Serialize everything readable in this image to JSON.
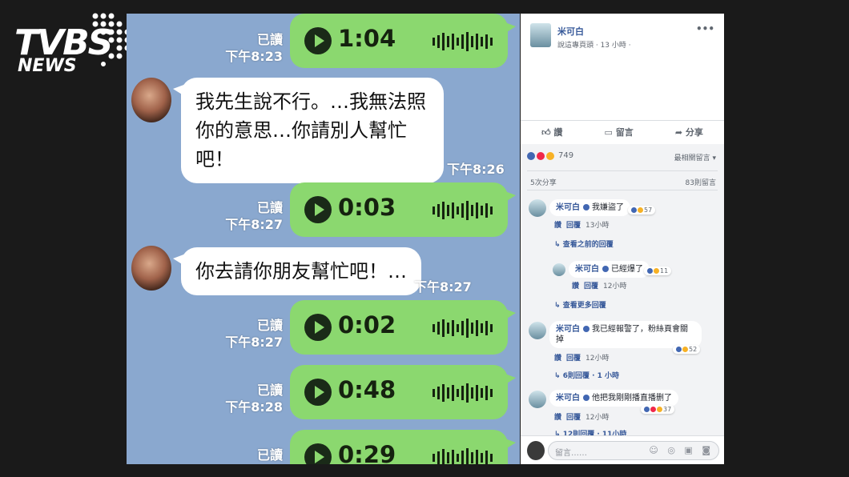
{
  "brand": {
    "line1": "TVBS",
    "line2": "NEWS"
  },
  "chat": {
    "voice_messages": [
      {
        "read": "已讀",
        "time": "下午8:23",
        "duration": "1:04"
      },
      {
        "read": "已讀",
        "time": "下午8:27",
        "duration": "0:03"
      },
      {
        "read": "已讀",
        "time": "下午8:27",
        "duration": "0:02"
      },
      {
        "read": "已讀",
        "time": "下午8:28",
        "duration": "0:48"
      },
      {
        "read": "已讀",
        "time": "",
        "duration": "0:29"
      }
    ],
    "incoming": [
      {
        "text_lines": [
          "我先生說不行。…我無法照",
          "你的意思…你請別人幫忙",
          "吧！"
        ],
        "time": "下午8:26"
      },
      {
        "text_lines": [
          "你去請你朋友幫忙吧！…"
        ],
        "time": "下午8:27"
      }
    ]
  },
  "facebook": {
    "page_name": "米可白",
    "page_meta": "說這專頁頭 · 13 小時 ·",
    "menu_icon": "more-icon",
    "actions": [
      {
        "icon": "like-icon",
        "label": "讚"
      },
      {
        "icon": "comment-icon",
        "label": "留言"
      },
      {
        "icon": "share-icon",
        "label": "分享"
      }
    ],
    "reaction_count": "749",
    "sort_label": "最相關留言 ▾",
    "shares": "5次分享",
    "comment_count": "83則留言",
    "comments": [
      {
        "name": "米可白",
        "text": "我嫌盜了",
        "reactions": "57",
        "like": "讚",
        "reply": "回覆",
        "time": "13小時"
      },
      {
        "name": "米可白",
        "text": "已經爆了",
        "reactions": "11",
        "like": "讚",
        "reply": "回覆",
        "time": "12小時"
      },
      {
        "name": "米可白",
        "text_lines": [
          "我已經報警了，粉絲頁會關",
          "掉"
        ],
        "reactions": "52",
        "like": "讚",
        "reply": "回覆",
        "time": "12小時"
      },
      {
        "name": "米可白",
        "text": "他把我剛剛播直播删了",
        "reactions": "37",
        "like": "讚",
        "reply": "回覆",
        "time": "12小時"
      }
    ],
    "view_previous": "查看之前的回覆",
    "view_more": "查看更多回覆",
    "replies_6": "6則回覆 · 1 小時",
    "replies_12": "12則回覆 · 11小時",
    "comment_placeholder": "留言……",
    "input_icons": "☺ ◎ ▣ ◙"
  }
}
